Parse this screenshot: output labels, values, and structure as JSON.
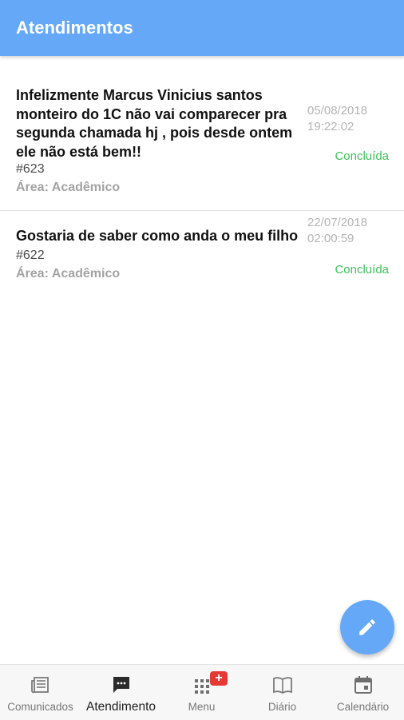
{
  "appbar": {
    "title": "Atendimentos"
  },
  "tickets": [
    {
      "message": "Infelizmente Marcus Vinicius santos monteiro do 1C não vai comparecer pra segunda chamada hj , pois desde ontem ele não está bem!!",
      "id": "#623",
      "area": "Área: Acadêmico",
      "date": "05/08/2018",
      "time": "19:22:02",
      "status": "Concluída"
    },
    {
      "message": "Gostaria de saber como anda o meu filho",
      "id": "#622",
      "area": "Área: Acadêmico",
      "date": "22/07/2018",
      "time": "02:00:59",
      "status": "Concluída"
    }
  ],
  "fab": {
    "icon": "pencil-icon"
  },
  "bottom_nav": {
    "items": [
      {
        "label": "Comunicados",
        "icon": "newspaper-icon",
        "active": false
      },
      {
        "label": "Atendimento",
        "icon": "chat-icon",
        "active": true
      },
      {
        "label": "Menu",
        "icon": "apps-grid-icon",
        "active": false,
        "badge": "+"
      },
      {
        "label": "Diário",
        "icon": "book-icon",
        "active": false
      },
      {
        "label": "Calendário",
        "icon": "calendar-icon",
        "active": false
      }
    ]
  },
  "colors": {
    "primary": "#64a8f7",
    "status_done": "#3ec15c",
    "badge": "#e53935"
  }
}
